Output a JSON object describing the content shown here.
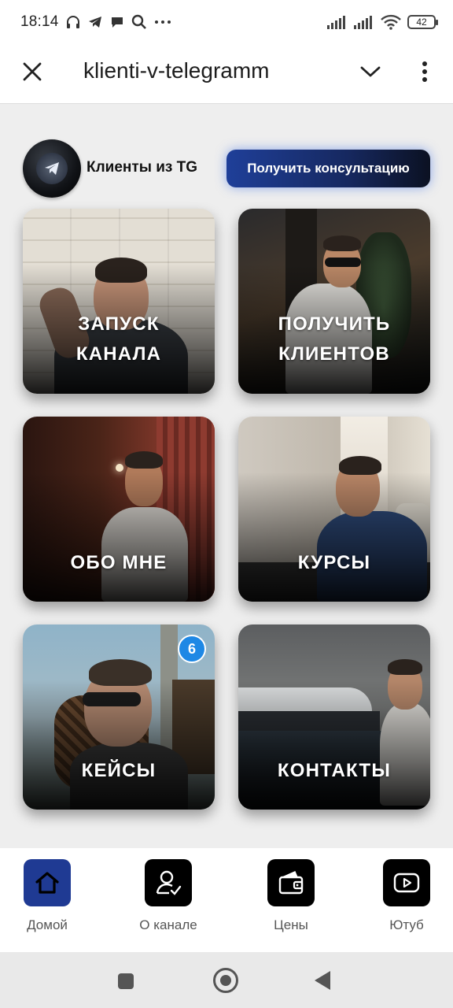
{
  "status_bar": {
    "time": "18:14",
    "battery": "42",
    "icons": [
      "headphones-icon",
      "telegram-icon",
      "chat-icon",
      "search-icon",
      "more-dots-icon",
      "signal-icon",
      "signal-icon",
      "wifi-icon",
      "battery-icon"
    ]
  },
  "app_bar": {
    "title": "klienti-v-telegramm",
    "close_icon": "close-icon",
    "dropdown_icon": "chevron-down-icon",
    "menu_icon": "more-vertical-icon"
  },
  "header": {
    "brand_name": "Клиенты из TG",
    "cta_label": "Получить консультацию",
    "cta_color": "#1f3f99"
  },
  "tiles": [
    {
      "label_line1": "ЗАПУСК",
      "label_line2": "КАНАЛА"
    },
    {
      "label_line1": "ПОЛУЧИТЬ",
      "label_line2": "КЛИЕНТОВ"
    },
    {
      "label": "ОБО МНЕ"
    },
    {
      "label": "КУРСЫ"
    },
    {
      "label": "КЕЙСЫ",
      "badge": "6"
    },
    {
      "label": "КОНТАКТЫ"
    }
  ],
  "bottom_nav": [
    {
      "label": "Домой",
      "icon": "home-icon",
      "active": true
    },
    {
      "label": "О канале",
      "icon": "user-check-icon",
      "active": false
    },
    {
      "label": "Цены",
      "icon": "wallet-icon",
      "active": false
    },
    {
      "label": "Ютуб",
      "icon": "youtube-icon",
      "active": false
    }
  ],
  "colors": {
    "accent": "#1f3a93",
    "badge": "#1e88e5",
    "background": "#eeeeee"
  }
}
